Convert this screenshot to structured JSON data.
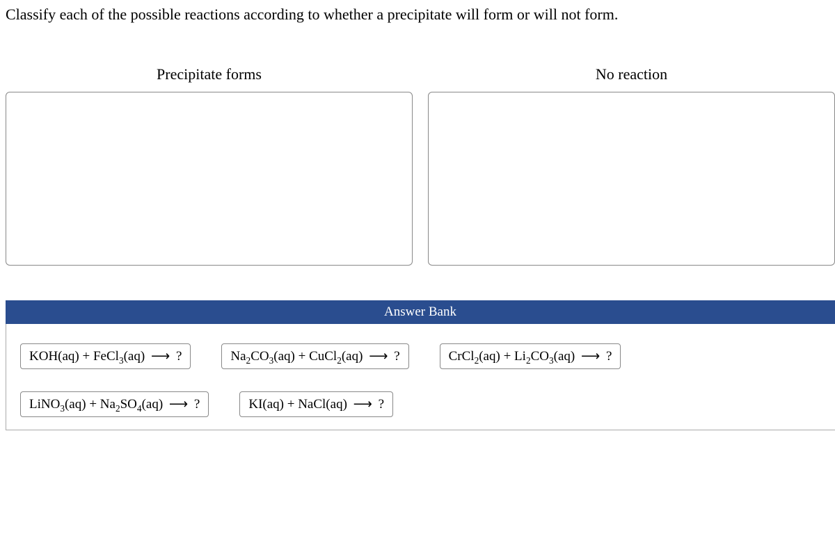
{
  "question": "Classify each of the possible reactions according to whether a precipitate will form or will not form.",
  "categories": {
    "left": "Precipitate forms",
    "right": "No reaction"
  },
  "answer_bank_title": "Answer Bank",
  "arrow": "⟶",
  "qmark": "?",
  "reactions": {
    "r1": {
      "a": "KOH(aq)",
      "b_pre": "FeCl",
      "b_sub": "3",
      "b_post": "(aq)"
    },
    "r2": {
      "a_pre": "Na",
      "a_sub": "2",
      "a_mid": "CO",
      "a_sub2": "3",
      "a_post": "(aq)",
      "b_pre": "CuCl",
      "b_sub": "2",
      "b_post": "(aq)"
    },
    "r3": {
      "a_pre": "CrCl",
      "a_sub": "2",
      "a_post": "(aq)",
      "b_pre": "Li",
      "b_sub": "2",
      "b_mid": "CO",
      "b_sub2": "3",
      "b_post": "(aq)"
    },
    "r4": {
      "a_pre": "LiNO",
      "a_sub": "3",
      "a_post": "(aq)",
      "b_pre": "Na",
      "b_sub": "2",
      "b_mid": "SO",
      "b_sub2": "4",
      "b_post": "(aq)"
    },
    "r5": {
      "a": "KI(aq)",
      "b": "NaCl(aq)"
    }
  }
}
